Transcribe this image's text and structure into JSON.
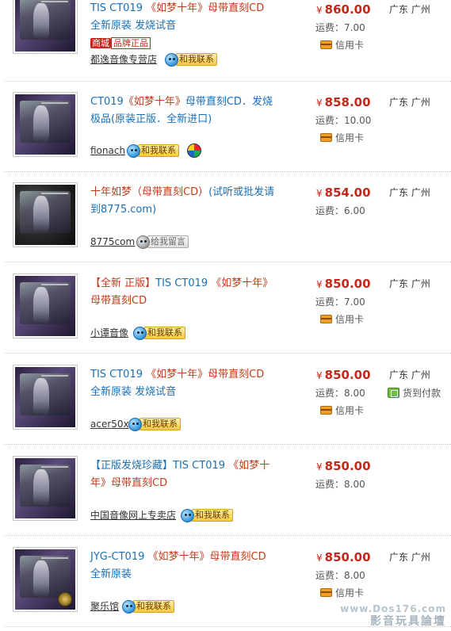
{
  "labels": {
    "shipping_prefix": "运费：",
    "credit_card": "信用卡",
    "cod": "货到付款",
    "currency": "¥",
    "contact_me": "和我联系",
    "leave_message": "给我留言"
  },
  "items": [
    {
      "title_parts": [
        [
          "TIS CT019 ",
          "acc"
        ],
        [
          "《如梦十年》",
          "hl"
        ],
        [
          "母带直刻CD",
          "hl"
        ]
      ],
      "subtitle": "全新原装 发烧试音",
      "promo_tm": "商城",
      "promo_pp": "品牌正品",
      "seller": "都逸音像专营店",
      "price": "860.00",
      "shipping": "7.00",
      "location": "广东 广州",
      "credit_card": true,
      "cod": false
    },
    {
      "title_parts": [
        [
          "CT019",
          "acc"
        ],
        [
          "《如梦十年》",
          "hl"
        ],
        [
          "母带直刻CD．发烧极品(原装正版．全新进口)",
          "acc"
        ]
      ],
      "seller": "fionach",
      "price": "858.00",
      "shipping": "10.00",
      "location": "广东 广州",
      "credit_card": true,
      "cod": false
    },
    {
      "title_parts": [
        [
          "十年如梦（母带直刻CD）",
          "hl"
        ],
        [
          "(试听或批发请到8775.com)",
          "acc"
        ]
      ],
      "seller": "8775com",
      "price": "854.00",
      "shipping": "6.00",
      "location": "广东 广州",
      "credit_card": false,
      "cod": false
    },
    {
      "title_parts": [
        [
          "【全新 正版】",
          "hl"
        ],
        [
          "TIS CT019 ",
          "acc"
        ],
        [
          "《如梦十年》母带直刻CD",
          "hl"
        ]
      ],
      "seller": "小谭音像",
      "price": "850.00",
      "shipping": "7.00",
      "location": "广东 广州",
      "credit_card": true,
      "cod": false
    },
    {
      "title_parts": [
        [
          "TIS CT019 ",
          "acc"
        ],
        [
          "《如梦十年》",
          "hl"
        ],
        [
          "母带直刻CD",
          "hl"
        ]
      ],
      "subtitle": "全新原装 发烧试音",
      "seller": "acer50x",
      "price": "850.00",
      "shipping": "8.00",
      "location": "广东 广州",
      "credit_card": true,
      "cod": true
    },
    {
      "title_parts": [
        [
          "【正版发烧珍藏】",
          "acc"
        ],
        [
          "TIS CT019 ",
          "acc"
        ],
        [
          "《如梦十年》母带直刻CD",
          "hl"
        ]
      ],
      "seller": "中国音像网上专卖店",
      "price": "850.00",
      "shipping": "8.00",
      "location": "",
      "credit_card": false,
      "cod": false
    },
    {
      "title_parts": [
        [
          "JYG-CT019 ",
          "acc"
        ],
        [
          "《如梦十年》",
          "hl"
        ],
        [
          "母带直刻CD",
          "hl"
        ]
      ],
      "subtitle": "全新原装",
      "seller": "聚乐馆",
      "price": "850.00",
      "shipping": "8.00",
      "location": "广东 广州",
      "credit_card": true,
      "cod": false
    }
  ],
  "watermark": {
    "line1": "www.Dos176.com",
    "line2": "影音玩具論壇"
  }
}
